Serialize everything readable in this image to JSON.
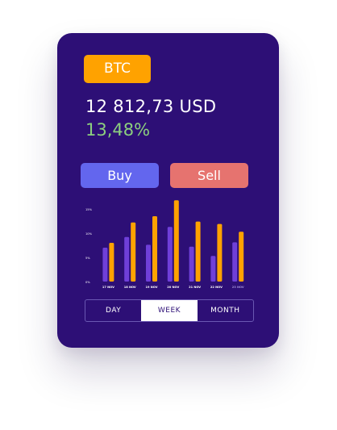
{
  "card": {
    "ticker": "BTC",
    "price": "12 812,73 USD",
    "change": "13,48%",
    "buy_label": "Buy",
    "sell_label": "Sell"
  },
  "chart_data": {
    "type": "bar",
    "categories": [
      "17 NOV",
      "18 NOV",
      "19 NOV",
      "20 NOV",
      "21 NOV",
      "22 NOV",
      "23 NOV"
    ],
    "y_ticks": [
      "15%",
      "10%",
      "5%",
      "0%"
    ],
    "ylim": [
      0,
      15
    ],
    "series": [
      {
        "color": "#6f3fd9",
        "values": [
          7.0,
          9.2,
          7.6,
          11.3,
          7.2,
          5.3,
          8.1
        ]
      },
      {
        "color": "#ffa200",
        "values": [
          8.0,
          12.2,
          13.5,
          16.8,
          12.4,
          11.9,
          10.3
        ]
      }
    ],
    "colors": {
      "muted_label": "#9f8fd6",
      "label": "#ffffff",
      "grid": "#4b2a94"
    }
  },
  "periods": {
    "day": "DAY",
    "week": "WEEK",
    "month": "MONTH",
    "active": "week"
  }
}
